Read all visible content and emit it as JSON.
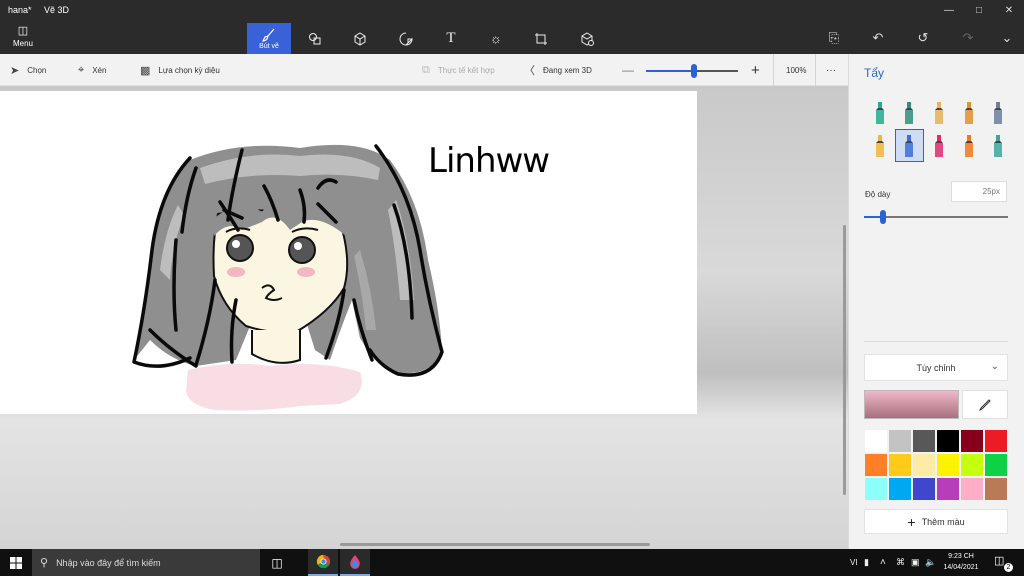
{
  "window": {
    "doc_name": "hana*",
    "app_name": "Vẽ 3D",
    "controls": [
      "minimize-icon",
      "maximize-icon",
      "close-icon"
    ]
  },
  "ribbon": {
    "menu_label": "Menu",
    "tools": [
      {
        "id": "brushes",
        "label": "Bút vẽ",
        "icon": "brush-icon",
        "active": true
      },
      {
        "id": "2d-shapes",
        "label": "",
        "icon": "2d-shapes-icon",
        "active": false
      },
      {
        "id": "3d-shapes",
        "label": "",
        "icon": "3d-cube-icon",
        "active": false
      },
      {
        "id": "stickers",
        "label": "",
        "icon": "sticker-icon",
        "active": false
      },
      {
        "id": "text",
        "label": "",
        "icon": "text-icon",
        "active": false
      },
      {
        "id": "effects",
        "label": "",
        "icon": "effects-icon",
        "active": false
      },
      {
        "id": "canvas",
        "label": "",
        "icon": "canvas-icon",
        "active": false
      },
      {
        "id": "3d-library",
        "label": "",
        "icon": "3d-library-icon",
        "active": false
      }
    ],
    "right_tools": [
      "paste-icon",
      "undo-icon",
      "history-icon",
      "redo-icon",
      "expand-chevron-icon"
    ]
  },
  "commandbar": {
    "select": "Chọn",
    "crop": "Xén",
    "magic_select": "Lựa chọn kỳ diệu",
    "mixed_reality": "Thực tế kết hợp",
    "view_3d": "Đang xem 3D",
    "zoom_value": "100%",
    "zoom_level": 0.52,
    "more": "···"
  },
  "drawing": {
    "signature": "Linhww"
  },
  "panel": {
    "title": "Tẩy",
    "brushes": [
      {
        "name": "marker-brush",
        "color": "#1fae8c"
      },
      {
        "name": "calligraphy-pen-brush",
        "color": "#2f8f7a"
      },
      {
        "name": "oil-brush",
        "color": "#e8b15a"
      },
      {
        "name": "watercolor-brush",
        "color": "#e0902c"
      },
      {
        "name": "pixel-pen-brush",
        "color": "#6b7fa0"
      },
      {
        "name": "pencil-brush",
        "color": "#f2b63c"
      },
      {
        "name": "eraser-brush",
        "color": "#3a6fd8",
        "active": true
      },
      {
        "name": "crayon-brush",
        "color": "#e02a6a"
      },
      {
        "name": "spray-can-brush",
        "color": "#f07a18"
      },
      {
        "name": "fill-brush",
        "color": "#3aa8a0"
      }
    ],
    "thickness_label": "Độ dày",
    "thickness_value": "25px",
    "thickness_level": 0.13,
    "color_mode": "Tùy chỉnh",
    "current_color": "#f0b8c8",
    "swatches": [
      "#ffffff",
      "#c3c3c3",
      "#585858",
      "#000000",
      "#88001b",
      "#ec1c24",
      "#ff7f27",
      "#ffca18",
      "#fdeca6",
      "#fff200",
      "#c4ff0e",
      "#0ed145",
      "#8cfffb",
      "#00a8f3",
      "#3f48cc",
      "#b83dba",
      "#ffaec8",
      "#b97a56"
    ],
    "add_color": "Thêm màu"
  },
  "taskbar": {
    "search_placeholder": "Nhập vào đây để tìm kiếm",
    "lang": "VI",
    "time": "9:23 CH",
    "date": "14/04/2021",
    "notification_count": "2"
  }
}
